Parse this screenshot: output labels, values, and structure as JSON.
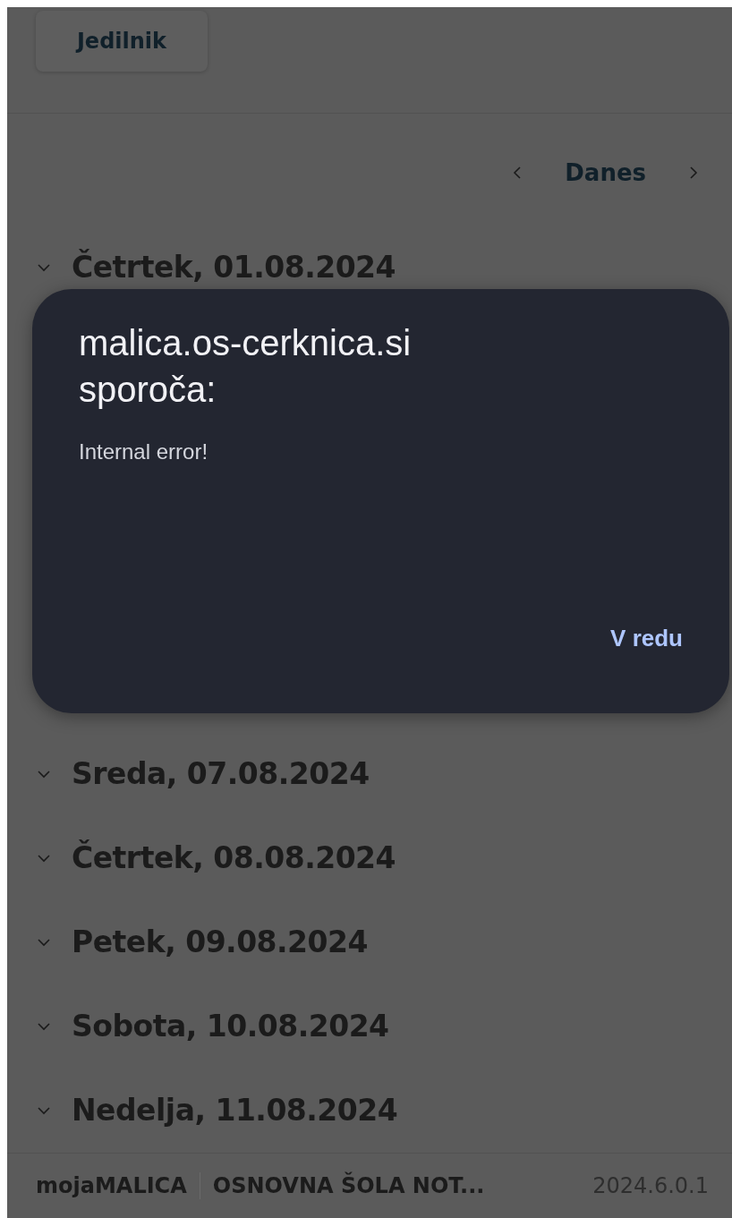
{
  "header": {
    "menu_button": "Jedilnik"
  },
  "date_nav": {
    "today": "Danes"
  },
  "days": [
    {
      "label": "Četrtek, 01.08.2024",
      "expanded": false
    },
    {
      "label": "Sreda, 07.08.2024",
      "expanded": false
    },
    {
      "label": "Četrtek, 08.08.2024",
      "expanded": false
    },
    {
      "label": "Petek, 09.08.2024",
      "expanded": false
    },
    {
      "label": "Sobota, 10.08.2024",
      "expanded": false
    },
    {
      "label": "Nedelja, 11.08.2024",
      "expanded": false
    }
  ],
  "footer": {
    "app_name": "mojaMALICA",
    "school": "OSNOVNA ŠOLA NOT...",
    "version": "2024.6.0.1"
  },
  "dialog": {
    "title": "malica.os-cerknica.si sporoča:",
    "message": "Internal error!",
    "button": "V redu"
  }
}
